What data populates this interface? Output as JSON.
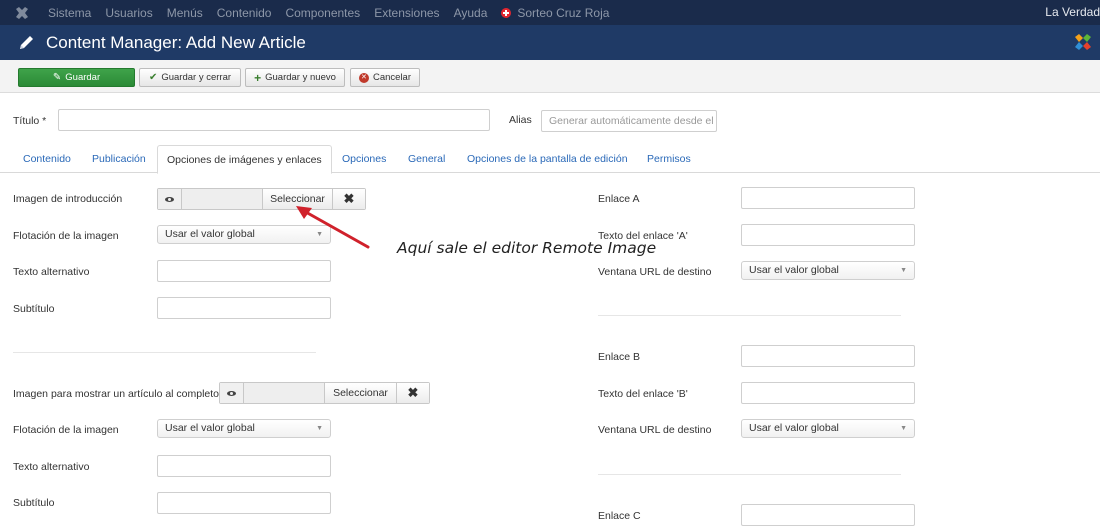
{
  "topnav": {
    "menu": [
      "Sistema",
      "Usuarios",
      "Menús",
      "Contenido",
      "Componentes",
      "Extensiones",
      "Ayuda"
    ],
    "sorteo": "Sorteo Cruz Roja",
    "right_text": "La Verdad"
  },
  "header": {
    "title": "Content Manager: Add New Article"
  },
  "toolbar": {
    "save": "Guardar",
    "save_close": "Guardar y cerrar",
    "save_new": "Guardar y nuevo",
    "cancel": "Cancelar"
  },
  "title_row": {
    "title_label": "Título *",
    "title_value": "",
    "alias_label": "Alias",
    "alias_placeholder": "Generar automáticamente desde el"
  },
  "tabs": [
    "Contenido",
    "Publicación",
    "Opciones de imágenes y enlaces",
    "Opciones",
    "General",
    "Opciones de la pantalla de edición",
    "Permisos"
  ],
  "active_tab": "Opciones de imágenes y enlaces",
  "intro": {
    "image_label": "Imagen de introducción",
    "select_label": "Seleccionar",
    "float_label": "Flotación de la imagen",
    "float_value": "Usar el valor global",
    "alt_label": "Texto alternativo",
    "caption_label": "Subtítulo"
  },
  "full": {
    "image_label": "Imagen para mostrar un artículo al completo",
    "select_label": "Seleccionar",
    "float_label": "Flotación de la imagen",
    "float_value": "Usar el valor global",
    "alt_label": "Texto alternativo",
    "caption_label": "Subtítulo"
  },
  "links": {
    "a_label": "Enlace A",
    "a_text_label": "Texto del enlace 'A'",
    "a_target_label": "Ventana URL de destino",
    "a_target_value": "Usar el valor global",
    "b_label": "Enlace B",
    "b_text_label": "Texto del enlace 'B'",
    "b_target_label": "Ventana URL de destino",
    "b_target_value": "Usar el valor global",
    "c_label": "Enlace C"
  },
  "annotation": "Aquí sale el editor Remote Image",
  "colors": {
    "topnav_bg": "#1a2b4b",
    "header_bg": "#1f3a66",
    "primary_button": "#2b8a36",
    "tab_link": "#2a69b8",
    "annotation_arrow": "#d0212b"
  }
}
